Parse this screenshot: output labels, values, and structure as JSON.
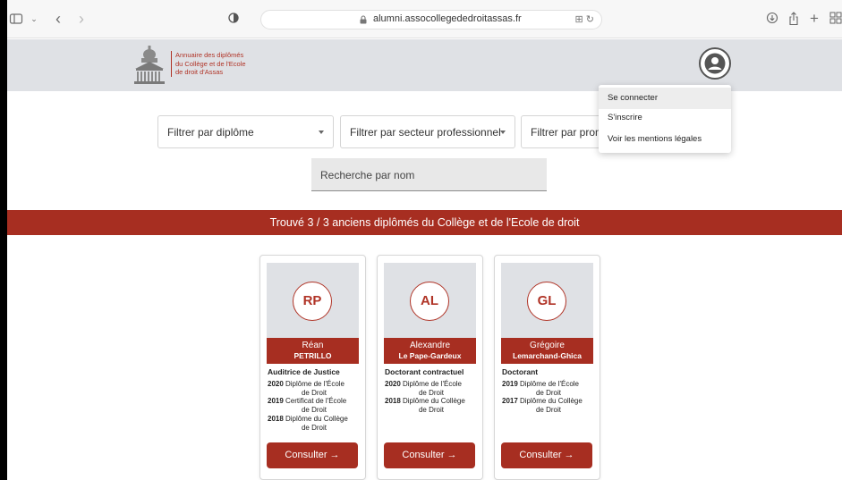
{
  "browser": {
    "url": "alumni.assocollegededroitassas.fr"
  },
  "header": {
    "logo_lines": [
      "Annuaire des diplômés",
      "du Collège et de l'Ecole",
      "de droit d'Assas"
    ]
  },
  "filters": {
    "diplome": "Filtrer par diplôme",
    "secteur": "Filtrer par secteur professionnel",
    "promo": "Filtrer par promo",
    "search_placeholder": "Recherche par nom"
  },
  "banner": "Trouvé 3 / 3 anciens diplômés du Collège et de l'Ecole de droit",
  "menu": {
    "items": [
      "Se connecter",
      "S'inscrire",
      "Voir les mentions légales"
    ]
  },
  "cards": [
    {
      "initials": "RP",
      "first": "Réan",
      "last": "PETRILLO",
      "status": "Auditrice de Justice",
      "diplomas": [
        {
          "year": "2020",
          "text1": "Diplôme de l'École",
          "text2": "de Droit"
        },
        {
          "year": "2019",
          "text1": "Certificat de l'École",
          "text2": "de Droit"
        },
        {
          "year": "2018",
          "text1": "Diplôme du Collège",
          "text2": "de Droit"
        }
      ],
      "button": "Consulter →"
    },
    {
      "initials": "AL",
      "first": "Alexandre",
      "last": "Le Pape-Gardeux",
      "status": "Doctorant contractuel",
      "diplomas": [
        {
          "year": "2020",
          "text1": "Diplôme de l'École",
          "text2": "de Droit"
        },
        {
          "year": "2018",
          "text1": "Diplôme du Collège",
          "text2": "de Droit"
        }
      ],
      "button": "Consulter →"
    },
    {
      "initials": "GL",
      "first": "Grégoire",
      "last": "Lemarchand-Ghica",
      "status": "Doctorant",
      "diplomas": [
        {
          "year": "2019",
          "text1": "Diplôme de l'École",
          "text2": "de Droit"
        },
        {
          "year": "2017",
          "text1": "Diplôme du Collège",
          "text2": "de Droit"
        }
      ],
      "button": "Consulter →"
    }
  ],
  "colors": {
    "brand": "#a72e21",
    "header_bg": "#dfe1e5"
  }
}
